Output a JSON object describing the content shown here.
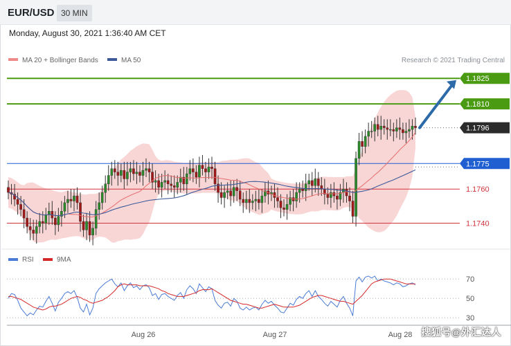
{
  "header": {
    "symbol": "EUR/USD",
    "timeframe": "30 MIN",
    "datetime": "Monday, August 30, 2021 1:36:40 AM CET"
  },
  "legend": {
    "ma20_label": "MA 20 + Bollinger Bands",
    "ma50_label": "MA 50",
    "credit": "Research © 2021 Trading Central"
  },
  "rsi_legend": {
    "rsi_label": "RSI",
    "ma_label": "9MA"
  },
  "x_axis_labels": [
    "Aug 26",
    "Aug 27",
    "Aug 28"
  ],
  "watermark": "搜狐号@外汇达人",
  "colors": {
    "resistance": "#4a9a12",
    "current": "#2b2b2b",
    "pivot": "#1f5fd1",
    "support": "#d2333b",
    "bollinger": "#f7c8c8",
    "ma20": "#e36a6a",
    "ma50": "#3c5a99",
    "bull_candle": "#2a8a2a",
    "bear_candle": "#a11818",
    "arrow": "#2d6aa8",
    "rsi": "#4a7bd6",
    "rsi_ma": "#d62828"
  },
  "chart_data": [
    {
      "type": "candlestick",
      "title": "EUR/USD",
      "timeframe": "30 MIN",
      "x_tick_labels": [
        "Aug 26",
        "Aug 27",
        "Aug 28"
      ],
      "ylim": [
        1.1728,
        1.1832
      ],
      "price_levels": [
        {
          "label": "1.1825",
          "value": 1.1825,
          "kind": "resistance"
        },
        {
          "label": "1.1810",
          "value": 1.181,
          "kind": "resistance"
        },
        {
          "label": "1.1796",
          "value": 1.1796,
          "kind": "last"
        },
        {
          "label": "1.1775",
          "value": 1.1775,
          "kind": "pivot"
        },
        {
          "label": "1.1760",
          "value": 1.176,
          "kind": "support"
        },
        {
          "label": "1.1740",
          "value": 1.174,
          "kind": "support"
        }
      ],
      "closes": [
        1.1758,
        1.1757,
        1.1754,
        1.1751,
        1.1748,
        1.1743,
        1.1738,
        1.1736,
        1.1734,
        1.1738,
        1.1741,
        1.174,
        1.1745,
        1.1747,
        1.1743,
        1.1739,
        1.1744,
        1.1747,
        1.1752,
        1.1754,
        1.1753,
        1.1756,
        1.1752,
        1.1741,
        1.1736,
        1.1741,
        1.1733,
        1.1737,
        1.1748,
        1.1752,
        1.1758,
        1.1763,
        1.1768,
        1.1772,
        1.177,
        1.1768,
        1.1771,
        1.1766,
        1.177,
        1.1772,
        1.1769,
        1.177,
        1.1768,
        1.1771,
        1.1772,
        1.177,
        1.1764,
        1.1765,
        1.1761,
        1.1764,
        1.1765,
        1.1763,
        1.1762,
        1.1761,
        1.1764,
        1.1767,
        1.1763,
        1.1769,
        1.1772,
        1.177,
        1.1767,
        1.1774,
        1.1772,
        1.177,
        1.1773,
        1.1772,
        1.1763,
        1.1758,
        1.1755,
        1.1758,
        1.1759,
        1.1756,
        1.1761,
        1.1759,
        1.1754,
        1.1752,
        1.1754,
        1.1752,
        1.1753,
        1.1754,
        1.1752,
        1.1756,
        1.1759,
        1.1757,
        1.1758,
        1.1755,
        1.1753,
        1.1749,
        1.1748,
        1.1751,
        1.1755,
        1.1753,
        1.1758,
        1.176,
        1.1759,
        1.1763,
        1.1765,
        1.1762,
        1.1766,
        1.1762,
        1.176,
        1.1757,
        1.1755,
        1.1758,
        1.1756,
        1.1754,
        1.1758,
        1.176,
        1.1756,
        1.1753,
        1.1744,
        1.1778,
        1.1788,
        1.1785,
        1.1791,
        1.1794,
        1.1794,
        1.1798,
        1.1795,
        1.1797,
        1.1796,
        1.1795,
        1.1795,
        1.1794,
        1.1796,
        1.1795,
        1.1793,
        1.1794,
        1.1795,
        1.1797,
        1.1796
      ],
      "last_close": 1.1796,
      "annotation": "arrow from last price pointing up toward 1.1825"
    },
    {
      "type": "line",
      "title": "RSI",
      "series_names": [
        "RSI",
        "9MA"
      ],
      "y_ticks": [
        70,
        50,
        30
      ],
      "ylim": [
        28,
        78
      ],
      "rsi": [
        50,
        55,
        54,
        48,
        40,
        36,
        32,
        35,
        33,
        38,
        42,
        41,
        47,
        52,
        45,
        37,
        46,
        50,
        55,
        57,
        55,
        58,
        51,
        40,
        36,
        44,
        33,
        40,
        55,
        60,
        63,
        66,
        68,
        70,
        65,
        62,
        66,
        58,
        63,
        66,
        61,
        63,
        59,
        63,
        64,
        61,
        53,
        55,
        49,
        54,
        55,
        52,
        50,
        48,
        53,
        56,
        50,
        59,
        63,
        60,
        55,
        65,
        61,
        57,
        62,
        60,
        48,
        43,
        40,
        45,
        46,
        42,
        50,
        47,
        40,
        38,
        41,
        38,
        40,
        41,
        38,
        44,
        48,
        45,
        47,
        43,
        40,
        36,
        35,
        40,
        45,
        43,
        49,
        52,
        50,
        55,
        58,
        52,
        58,
        52,
        49,
        45,
        42,
        47,
        44,
        41,
        48,
        52,
        45,
        40,
        32,
        68,
        72,
        67,
        72,
        73,
        71,
        73,
        68,
        70,
        68,
        67,
        66,
        64,
        66,
        65,
        62,
        63,
        65,
        66,
        64
      ],
      "rsi_9ma": [
        52,
        52,
        51,
        50,
        49,
        47,
        45,
        43,
        41,
        40,
        39,
        38,
        39,
        41,
        42,
        42,
        43,
        44,
        46,
        48,
        50,
        51,
        52,
        51,
        49,
        48,
        46,
        45,
        46,
        47,
        48,
        50,
        52,
        55,
        58,
        62,
        64,
        65,
        64,
        64,
        64,
        64,
        63,
        63,
        63,
        63,
        62,
        61,
        60,
        58,
        57,
        55,
        54,
        53,
        52,
        52,
        52,
        53,
        54,
        55,
        56,
        58,
        59,
        59,
        59,
        60,
        58,
        56,
        54,
        52,
        50,
        48,
        47,
        46,
        45,
        44,
        44,
        43,
        42,
        41,
        40,
        40,
        41,
        42,
        43,
        44,
        43,
        42,
        41,
        41,
        41,
        41,
        42,
        43,
        45,
        47,
        49,
        51,
        52,
        53,
        53,
        52,
        51,
        50,
        49,
        48,
        47,
        47,
        46,
        45,
        44,
        47,
        50,
        53,
        57,
        61,
        65,
        67,
        68,
        69,
        70,
        70,
        70,
        69,
        68,
        67,
        66,
        65,
        65,
        65,
        65
      ],
      "x_tick_labels": [
        "Aug 26",
        "Aug 27",
        "Aug 28"
      ]
    }
  ]
}
